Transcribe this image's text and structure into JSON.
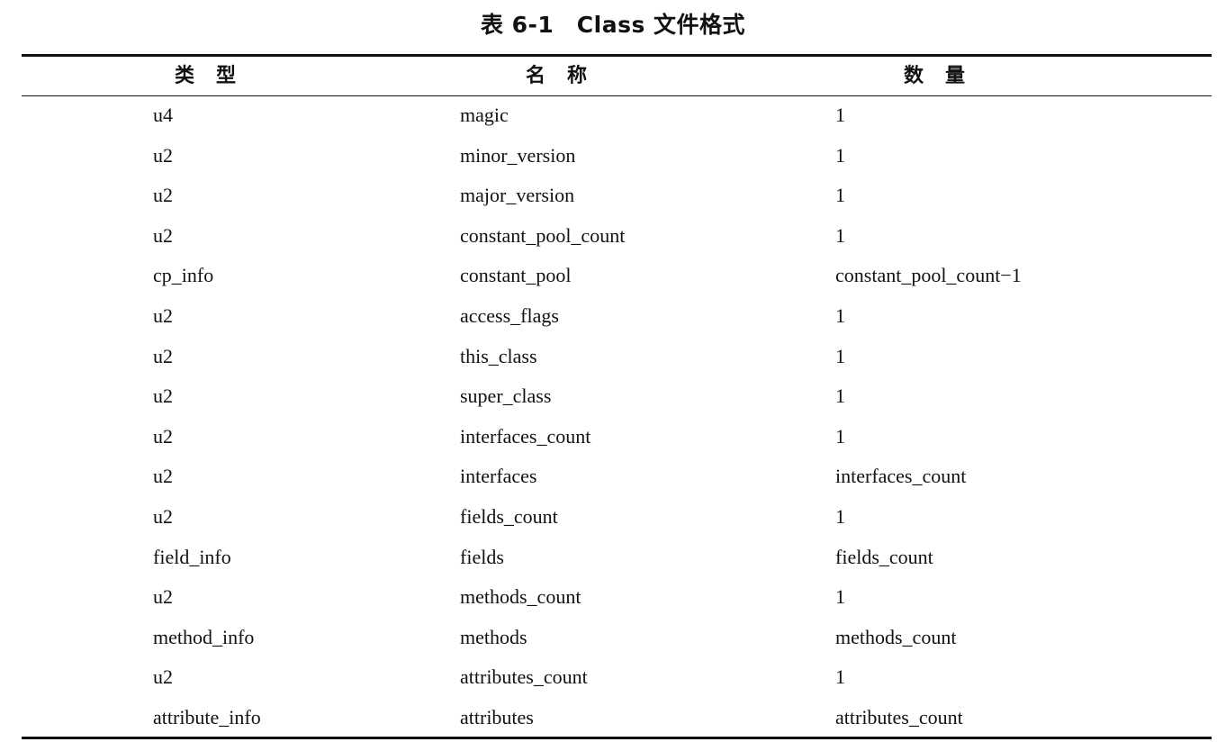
{
  "caption": "表 6-1　Class 文件格式",
  "headers": {
    "type": "类型",
    "name": "名称",
    "count": "数量"
  },
  "rows": [
    {
      "type": "u4",
      "name": "magic",
      "count": "1"
    },
    {
      "type": "u2",
      "name": "minor_version",
      "count": "1"
    },
    {
      "type": "u2",
      "name": "major_version",
      "count": "1"
    },
    {
      "type": "u2",
      "name": "constant_pool_count",
      "count": "1"
    },
    {
      "type": "cp_info",
      "name": "constant_pool",
      "count": "constant_pool_count−1"
    },
    {
      "type": "u2",
      "name": "access_flags",
      "count": "1"
    },
    {
      "type": "u2",
      "name": "this_class",
      "count": "1"
    },
    {
      "type": "u2",
      "name": "super_class",
      "count": "1"
    },
    {
      "type": "u2",
      "name": "interfaces_count",
      "count": "1"
    },
    {
      "type": "u2",
      "name": "interfaces",
      "count": "interfaces_count"
    },
    {
      "type": "u2",
      "name": "fields_count",
      "count": "1"
    },
    {
      "type": "field_info",
      "name": "fields",
      "count": "fields_count"
    },
    {
      "type": "u2",
      "name": "methods_count",
      "count": "1"
    },
    {
      "type": "method_info",
      "name": "methods",
      "count": "methods_count"
    },
    {
      "type": "u2",
      "name": "attributes_count",
      "count": "1"
    },
    {
      "type": "attribute_info",
      "name": "attributes",
      "count": "attributes_count"
    }
  ]
}
